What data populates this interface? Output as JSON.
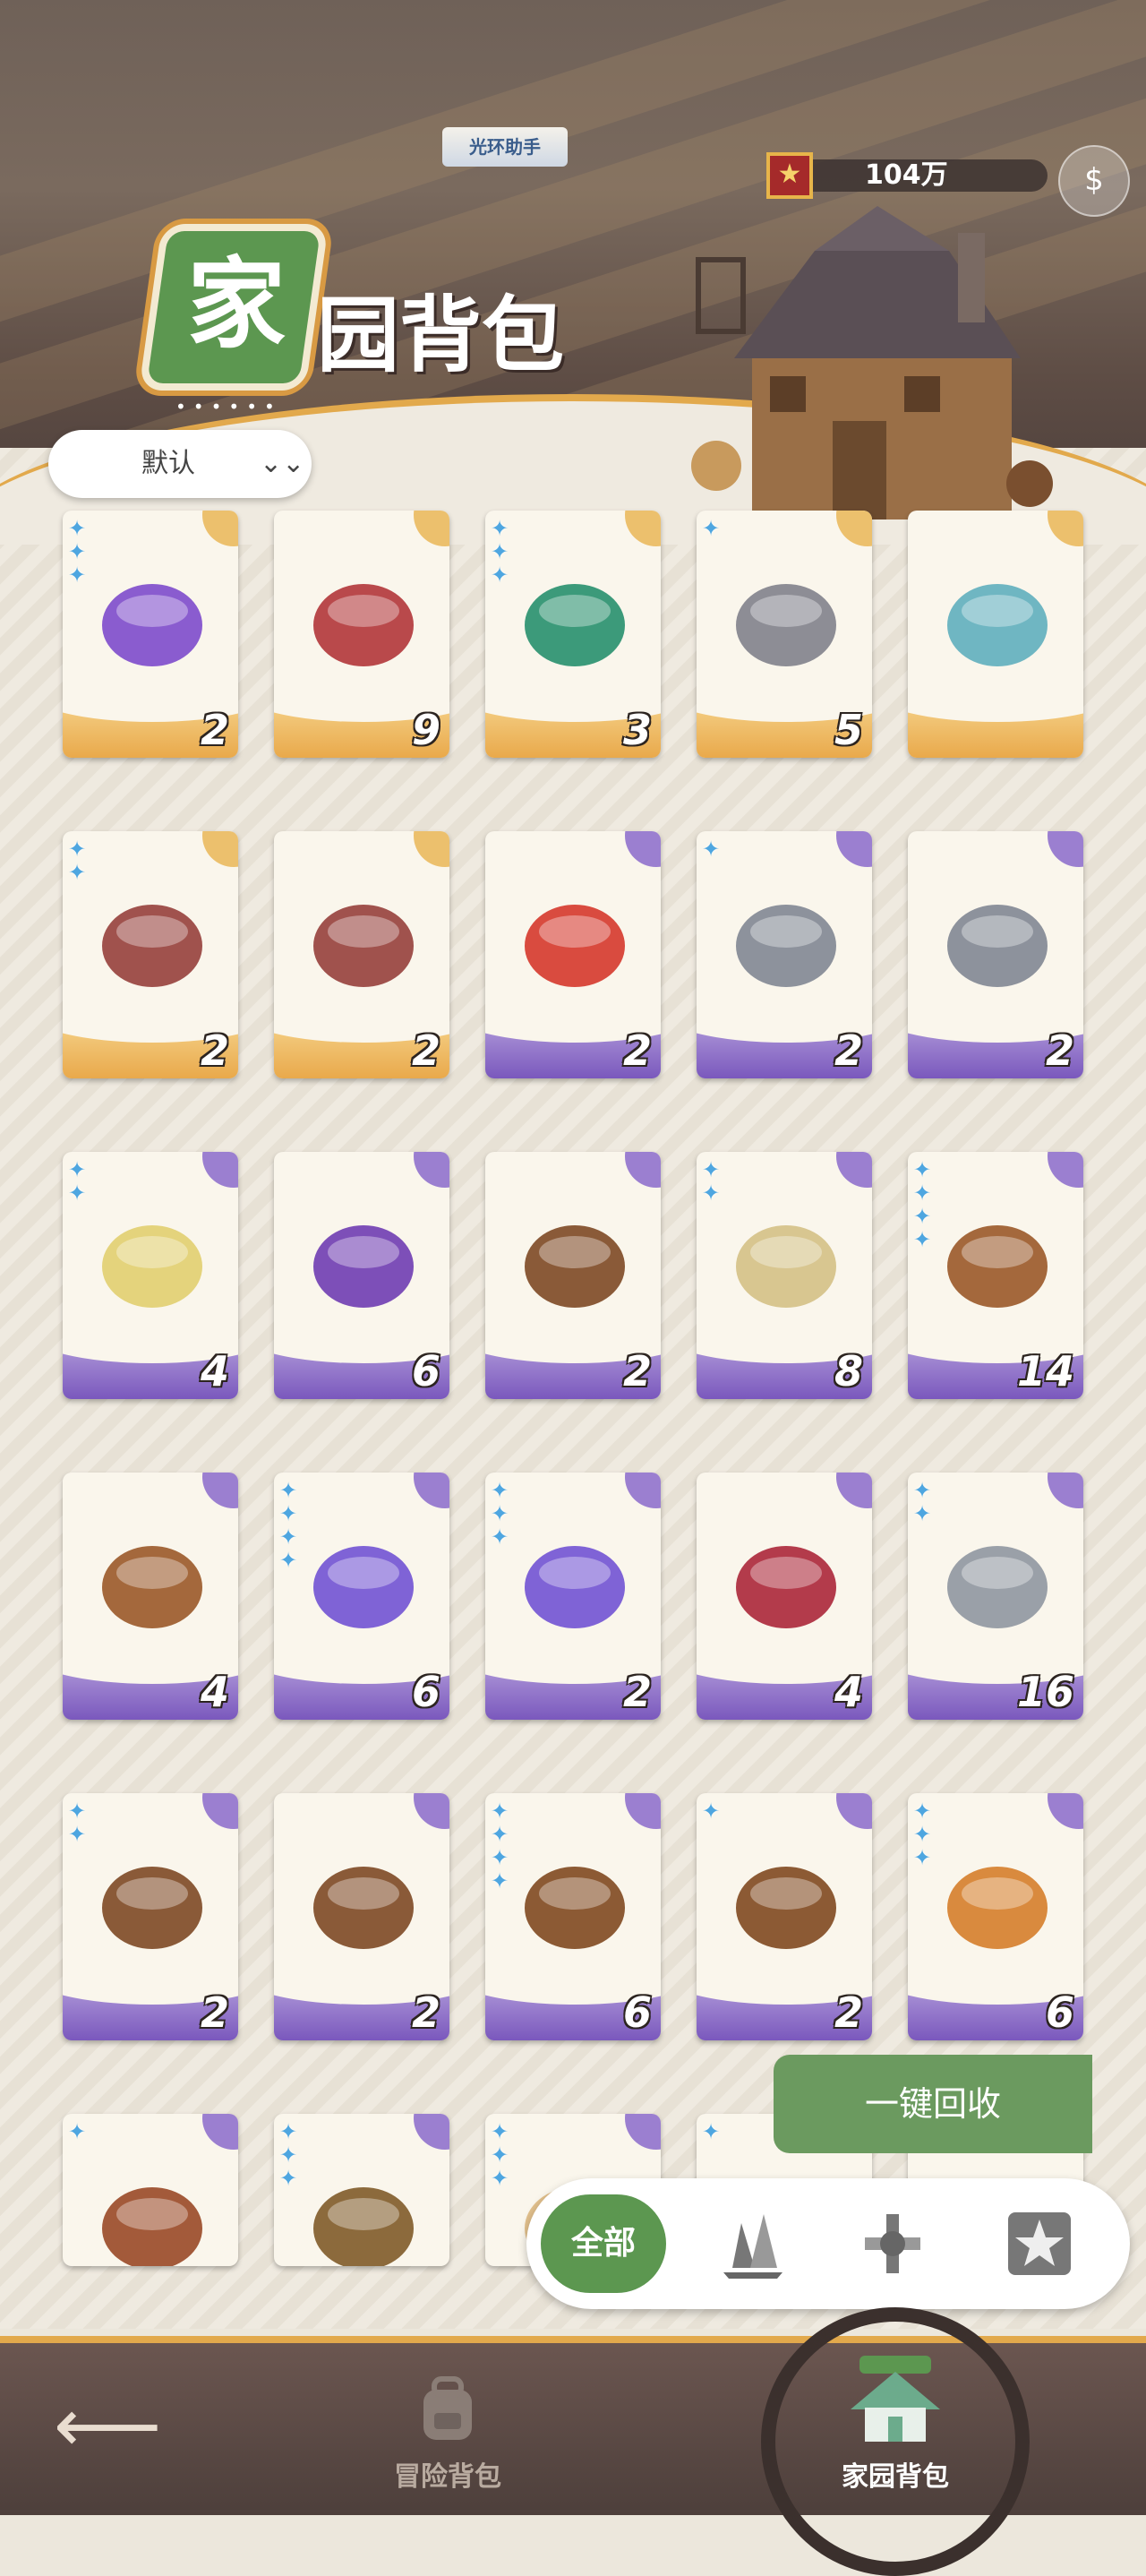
{
  "header": {
    "assistant_tag": "光环助手",
    "currency_value": "104万",
    "title_first": "家",
    "title_rest": "园背包",
    "title_dots": "••••••"
  },
  "sort": {
    "label": "默认"
  },
  "items": [
    {
      "qty": "2",
      "stars": 3,
      "rarity": "gold",
      "icon": "potion-bottle-icon",
      "color": "#8a5ccf"
    },
    {
      "qty": "9",
      "stars": 0,
      "rarity": "gold",
      "icon": "stew-pan-icon",
      "color": "#b9494b"
    },
    {
      "qty": "3",
      "stars": 3,
      "rarity": "gold",
      "icon": "green-incense-icon",
      "color": "#3c9a7a"
    },
    {
      "qty": "5",
      "stars": 1,
      "rarity": "gold",
      "icon": "spiked-armor-icon",
      "color": "#8d8d95"
    },
    {
      "qty": "",
      "stars": 0,
      "rarity": "gold",
      "icon": "teal-jar-icon",
      "color": "#6fb6c2"
    },
    {
      "qty": "2",
      "stars": 2,
      "rarity": "gold",
      "icon": "mushroom-icon",
      "color": "#a0524d"
    },
    {
      "qty": "2",
      "stars": 0,
      "rarity": "gold",
      "icon": "mushroom-icon",
      "color": "#a0524d"
    },
    {
      "qty": "2",
      "stars": 0,
      "rarity": "purple",
      "icon": "red-sauce-bowl-icon",
      "color": "#d94b3f"
    },
    {
      "qty": "2",
      "stars": 1,
      "rarity": "purple",
      "icon": "iron-armor-icon",
      "color": "#8d929c"
    },
    {
      "qty": "2",
      "stars": 0,
      "rarity": "purple",
      "icon": "iron-armor-icon",
      "color": "#8d929c"
    },
    {
      "qty": "4",
      "stars": 2,
      "rarity": "purple",
      "icon": "grain-bowl-icon",
      "color": "#e4d37c"
    },
    {
      "qty": "6",
      "stars": 0,
      "rarity": "purple",
      "icon": "purple-salad-icon",
      "color": "#7d4fb8"
    },
    {
      "qty": "2",
      "stars": 0,
      "rarity": "purple",
      "icon": "leather-armor-icon",
      "color": "#8a5a38"
    },
    {
      "qty": "8",
      "stars": 2,
      "rarity": "purple",
      "icon": "dumpling-bowl-icon",
      "color": "#d8c690"
    },
    {
      "qty": "14",
      "stars": 4,
      "rarity": "purple",
      "icon": "clay-pot-icon",
      "color": "#a4683c"
    },
    {
      "qty": "4",
      "stars": 0,
      "rarity": "purple",
      "icon": "clay-pot-icon",
      "color": "#a4683c"
    },
    {
      "qty": "6",
      "stars": 4,
      "rarity": "purple",
      "icon": "purple-vase-icon",
      "color": "#7f63d6"
    },
    {
      "qty": "2",
      "stars": 3,
      "rarity": "purple",
      "icon": "purple-vase-icon",
      "color": "#7f63d6"
    },
    {
      "qty": "4",
      "stars": 0,
      "rarity": "purple",
      "icon": "berry-bowl-icon",
      "color": "#b33b4b"
    },
    {
      "qty": "16",
      "stars": 2,
      "rarity": "purple",
      "icon": "dagger-icon",
      "color": "#9aa0a8"
    },
    {
      "qty": "2",
      "stars": 2,
      "rarity": "purple",
      "icon": "arrow-icon",
      "color": "#8a5a38"
    },
    {
      "qty": "2",
      "stars": 0,
      "rarity": "purple",
      "icon": "arrow-icon",
      "color": "#8a5a38"
    },
    {
      "qty": "6",
      "stars": 4,
      "rarity": "purple",
      "icon": "chest-icon",
      "color": "#8c5a34"
    },
    {
      "qty": "2",
      "stars": 1,
      "rarity": "purple",
      "icon": "chest-icon",
      "color": "#8c5a34"
    },
    {
      "qty": "6",
      "stars": 3,
      "rarity": "purple",
      "icon": "bread-icon",
      "color": "#d98a3e"
    },
    {
      "qty": "",
      "stars": 1,
      "rarity": "purple",
      "icon": "horn-icon",
      "color": "#a35a3a"
    },
    {
      "qty": "",
      "stars": 3,
      "rarity": "purple",
      "icon": "belt-icon",
      "color": "#8c6a3c"
    },
    {
      "qty": "",
      "stars": 3,
      "rarity": "purple",
      "icon": "cloth-icon",
      "color": "#e2c08c"
    },
    {
      "qty": "",
      "stars": 1,
      "rarity": "purple",
      "icon": "scroll-icon",
      "color": "#d8cbb0"
    },
    {
      "qty": "",
      "stars": 0,
      "rarity": "purple",
      "icon": "scroll-icon",
      "color": "#d8cbb0"
    }
  ],
  "actions": {
    "recycle_label": "一键回收"
  },
  "filters": {
    "all_label": "全部",
    "icons": [
      "crystal-cluster-icon",
      "tool-parts-icon",
      "star-badge-icon"
    ]
  },
  "nav": {
    "adventure_label": "冒险背包",
    "home_label": "家园背包"
  },
  "colors": {
    "accent_green": "#5c9750",
    "gold_band": "#e9a94b",
    "purple_band": "#7a58bd",
    "star_blue": "#4ea6e0"
  }
}
